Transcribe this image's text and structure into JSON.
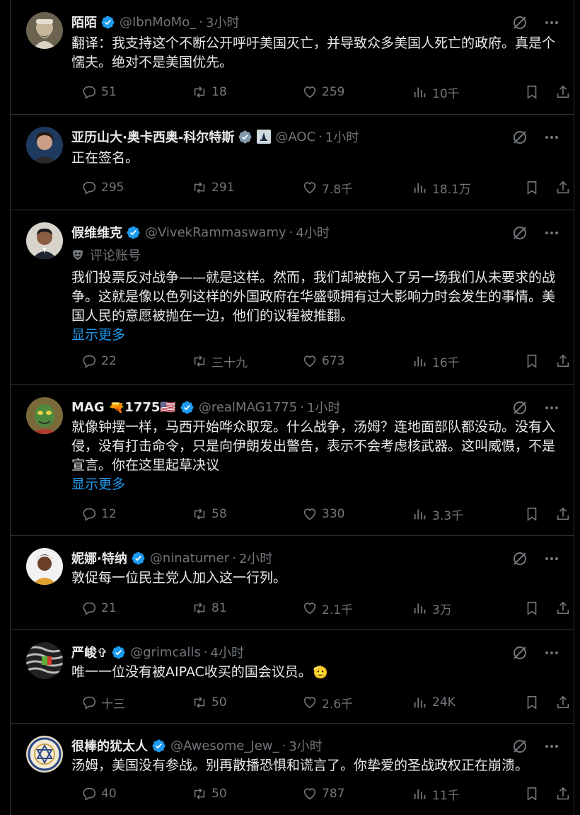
{
  "posts": [
    {
      "name": "陌陌",
      "handle": "@IbnMoMo_",
      "time": "3小时",
      "text": "翻译：我支持这个不断公开呼吁美国灭亡，并导致众多美国人死亡的政府。真是个懦夫。绝对不是美国优先。",
      "replies": "51",
      "retweets": "18",
      "likes": "259",
      "views": "10千"
    },
    {
      "name": "亚历山大·奥卡西奥-科尔特斯",
      "handle": "@AOC",
      "time": "1小时",
      "text": "正在签名。",
      "replies": "295",
      "retweets": "291",
      "likes": "7.8千",
      "views": "18.1万"
    },
    {
      "name": "假维维克",
      "handle": "@VivekRammaswamy",
      "time": "4小时",
      "commentary": "评论账号",
      "text": "我们投票反对战争——就是这样。然而，我们却被拖入了另一场我们从未要求的战争。这就是像以色列这样的外国政府在华盛顿拥有过大影响力时会发生的事情。美国人民的意愿被抛在一边，他们的议程被推翻。",
      "show_more": "显示更多",
      "replies": "22",
      "retweets": "三十九",
      "likes": "673",
      "views": "16千"
    },
    {
      "name": "MAG 🔫1775🇺🇸",
      "handle": "@realMAG1775",
      "time": "1小时",
      "text": "就像钟摆一样，马西开始哗众取宠。什么战争，汤姆？连地面部队都没动。没有入侵，没有打击命令，只是向伊朗发出警告，表示不会考虑核武器。这叫威慑，不是宣言。你在这里起草决议",
      "show_more": "显示更多",
      "replies": "12",
      "retweets": "58",
      "likes": "330",
      "views": "3.3千"
    },
    {
      "name": "妮娜·特纳",
      "handle": "@ninaturner",
      "time": "2小时",
      "text": "敦促每一位民主党人加入这一行列。",
      "replies": "21",
      "retweets": "81",
      "likes": "2.1千",
      "views": "3万"
    },
    {
      "name": "严峻✞",
      "handle": "@grimcalls",
      "time": "4小时",
      "text": "唯一一位没有被AIPAC收买的国会议员。",
      "emoji": "🫡",
      "replies": "十三",
      "retweets": "50",
      "likes": "2.6千",
      "views": "24K"
    },
    {
      "name": "很棒的犹太人",
      "handle": "@Awesome_Jew_",
      "time": "3小时",
      "text": "汤姆，美国没有参战。别再散播恐惧和谎言了。你挚爱的圣战政权正在崩溃。",
      "replies": "40",
      "retweets": "50",
      "likes": "787",
      "views": "11千"
    }
  ],
  "colors": {
    "background": "#000000",
    "text": "#e7e9ea",
    "secondary": "#71767b",
    "link": "#1d9bf0",
    "verified": "#1d9bf0",
    "divider": "#2f3336"
  }
}
